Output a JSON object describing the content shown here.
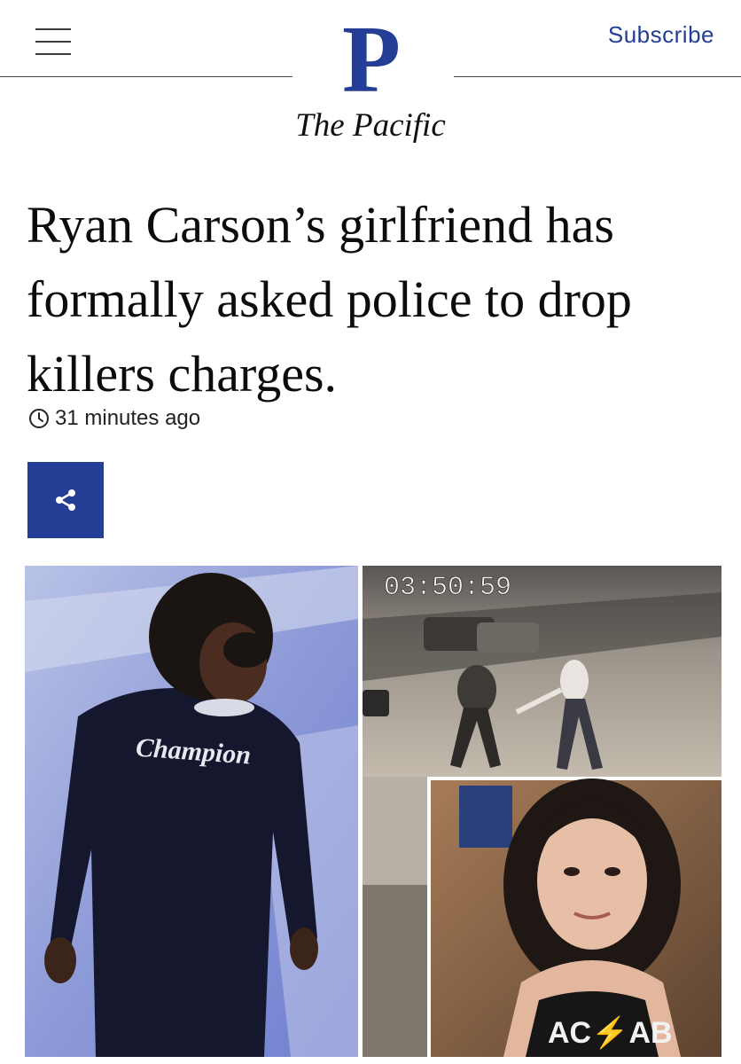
{
  "header": {
    "menu_icon": "hamburger-menu-icon",
    "logo_letter": "P",
    "brand_name": "The Pacific",
    "subscribe_label": "Subscribe",
    "brand_color": "#243d95"
  },
  "article": {
    "headline": "Ryan Carson’s girlfriend has formally asked police to drop killers charges.",
    "timestamp": "31 minutes ago",
    "timestamp_icon": "clock-icon",
    "share_icon": "share-icon",
    "image": {
      "cctv_timestamp": "03:50:59",
      "shirt_text": "Champion",
      "tank_text": "AC⚡AB"
    }
  }
}
